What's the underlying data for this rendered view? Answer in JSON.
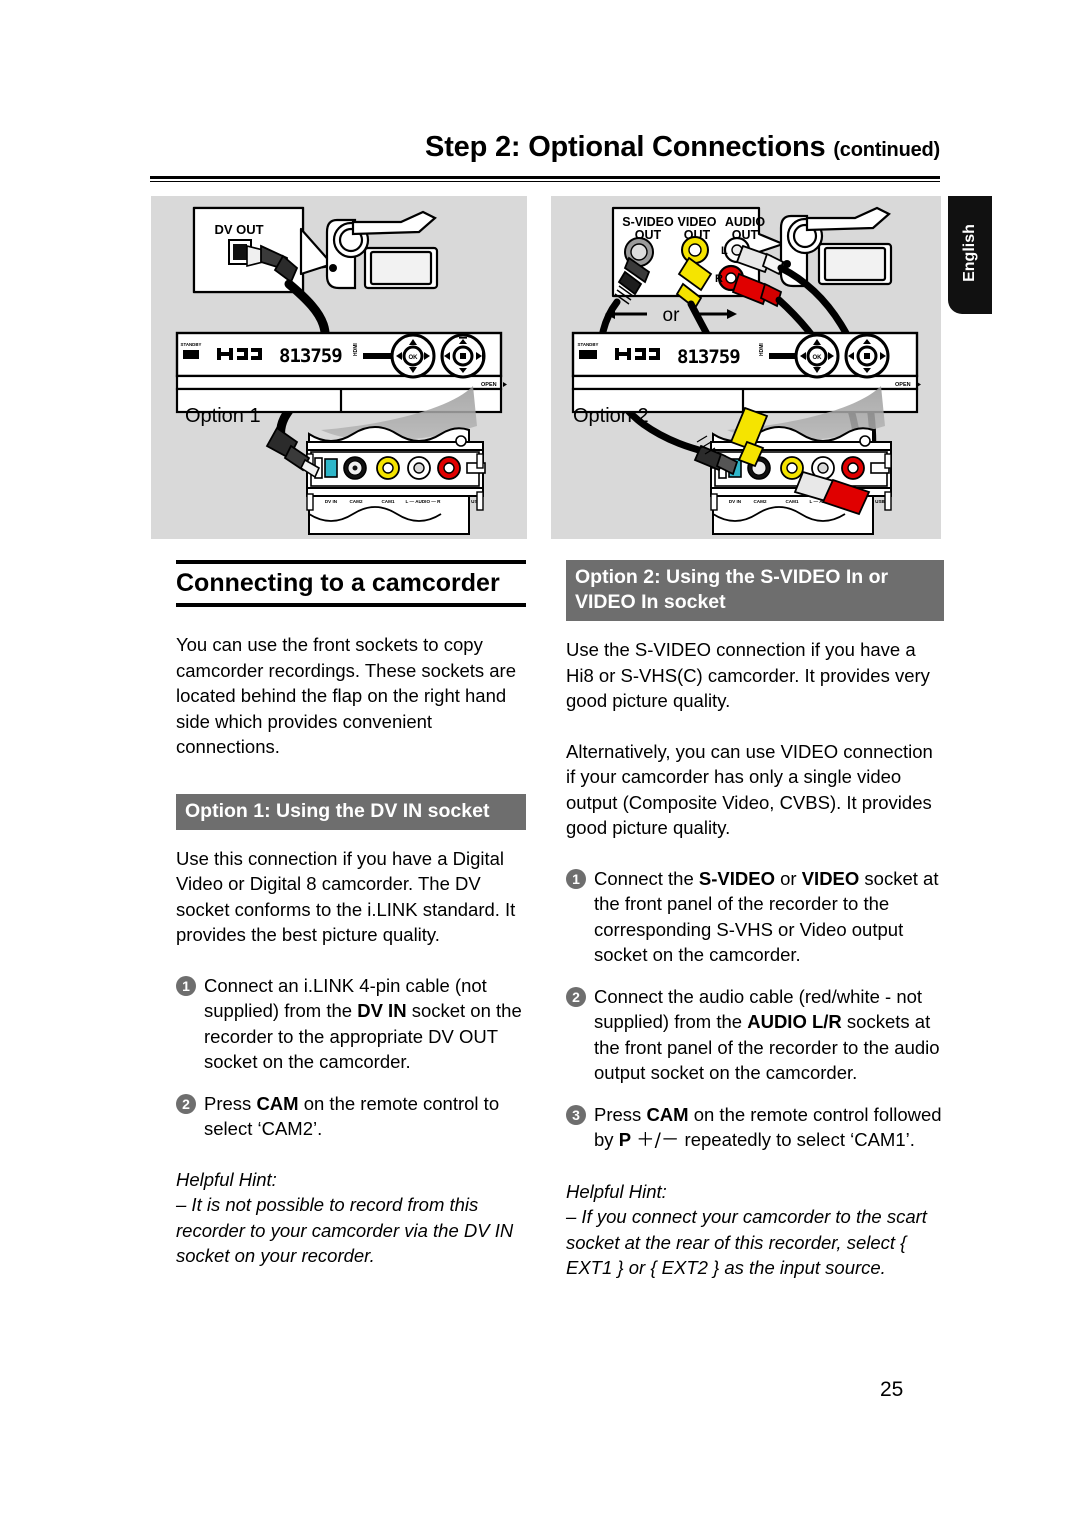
{
  "header": {
    "title_main": "Step 2: Optional Connections",
    "title_suffix": "(continued)"
  },
  "lang_tab": {
    "label": "English"
  },
  "page_number": "25",
  "figures": [
    {
      "id": "figure-option-1",
      "caption": "Option 1",
      "callout_labels": [
        "DV OUT"
      ],
      "recorder_display": "813759",
      "recorder_marks": [
        "HDD",
        "HDMI",
        "OPEN"
      ],
      "front_socket_labels": [
        "DV IN",
        "CAM2",
        "CAM1",
        "L – AUDIO – R",
        "USB"
      ]
    },
    {
      "id": "figure-option-2",
      "caption": "Option 2",
      "callout_labels": [
        "S-VIDEO OUT",
        "VIDEO OUT",
        "AUDIO OUT"
      ],
      "channel_labels": [
        "L",
        "R"
      ],
      "or_label": "or",
      "recorder_display": "813759",
      "recorder_marks": [
        "HDD",
        "HDMI",
        "OPEN"
      ],
      "front_socket_labels": [
        "DV IN",
        "CAM2",
        "CAM1",
        "L – AUDIO – R",
        "USB"
      ]
    }
  ],
  "left_column": {
    "section_title": "Connecting to a camcorder",
    "intro": "You can use the front sockets to copy camcorder recordings. These sockets are located behind the flap on the right hand side which provides convenient connections.",
    "option_bar": "Option 1: Using the DV IN socket",
    "body": "Use this connection if you have a Digital Video or Digital 8 camcorder. The DV socket conforms to the i.LINK standard. It provides the best picture quality.",
    "steps": [
      {
        "num": "1",
        "html": "Connect an i.LINK 4-pin cable (not supplied) from the <b>DV IN</b> socket on the recorder to the appropriate DV OUT socket on the camcorder."
      },
      {
        "num": "2",
        "html": "Press <b>CAM</b> on the remote control to select ‘CAM2’."
      }
    ],
    "hint_title": "Helpful Hint:",
    "hint_body": "– It is not possible to record from this recorder to your camcorder via the DV IN socket on your recorder."
  },
  "right_column": {
    "option_bar": "Option 2: Using the S-VIDEO In or VIDEO In socket",
    "body1": "Use the S-VIDEO connection if you have a Hi8 or S-VHS(C) camcorder. It provides very good picture quality.",
    "body2": "Alternatively, you can use VIDEO connection if your camcorder has only a single video output (Composite Video, CVBS). It provides good picture quality.",
    "steps": [
      {
        "num": "1",
        "html": "Connect the <b>S-VIDEO</b> or <b>VIDEO</b> socket at the front panel of the recorder to the corresponding S-VHS or Video output socket on the camcorder."
      },
      {
        "num": "2",
        "html": "Connect the audio cable (red/white - not supplied) from the <b>AUDIO L/R</b> sockets at the front panel of the recorder to the audio output socket on the camcorder."
      },
      {
        "num": "3",
        "html": "Press <b>CAM</b> on the remote control followed by <b>P</b> <span class=\"pm\">＋/－</span> repeatedly to select ‘CAM1’."
      }
    ],
    "hint_title": "Helpful Hint:",
    "hint_body": "– If you connect your camcorder to the scart socket at the rear of this recorder, select { EXT1 } or { EXT2 } as the input source."
  },
  "colors": {
    "figure_bg": "#d9d9d9",
    "grey_bar": "#6e6e6e",
    "tab_bg": "#111111",
    "yellow": "#f5e400",
    "red": "#e00000",
    "white_plug": "#e8e8e8"
  }
}
